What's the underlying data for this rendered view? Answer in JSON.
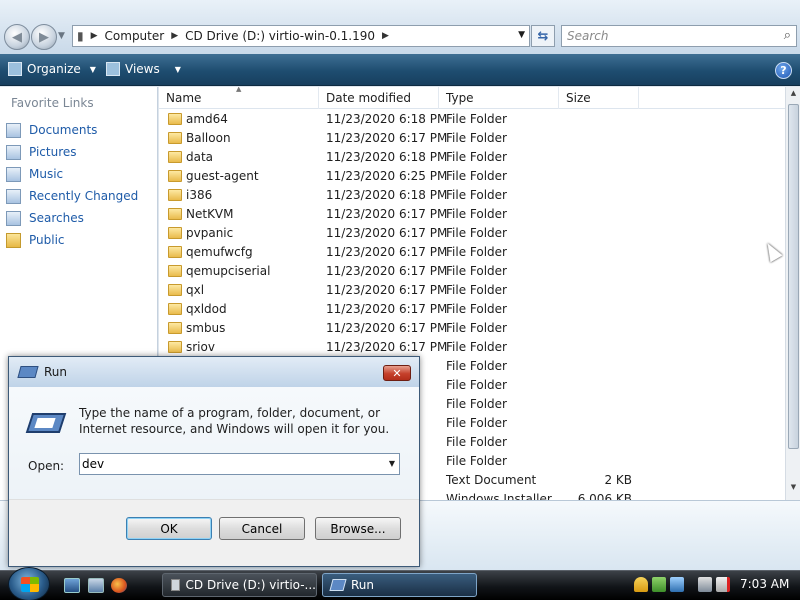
{
  "explorer": {
    "address": {
      "segments": [
        "Computer",
        "CD Drive (D:) virtio-win-0.1.190"
      ]
    },
    "search_placeholder": "Search",
    "toolbar": {
      "organize": "Organize",
      "views": "Views",
      "help": "?"
    },
    "nav_pane": {
      "heading": "Favorite Links",
      "items": [
        "Documents",
        "Pictures",
        "Music",
        "Recently Changed",
        "Searches",
        "Public"
      ]
    },
    "columns": {
      "name": "Name",
      "date": "Date modified",
      "type": "Type",
      "size": "Size"
    },
    "rows": [
      {
        "name": "amd64",
        "date": "11/23/2020 6:18 PM",
        "type": "File Folder",
        "size": ""
      },
      {
        "name": "Balloon",
        "date": "11/23/2020 6:17 PM",
        "type": "File Folder",
        "size": ""
      },
      {
        "name": "data",
        "date": "11/23/2020 6:18 PM",
        "type": "File Folder",
        "size": ""
      },
      {
        "name": "guest-agent",
        "date": "11/23/2020 6:25 PM",
        "type": "File Folder",
        "size": ""
      },
      {
        "name": "i386",
        "date": "11/23/2020 6:18 PM",
        "type": "File Folder",
        "size": ""
      },
      {
        "name": "NetKVM",
        "date": "11/23/2020 6:17 PM",
        "type": "File Folder",
        "size": ""
      },
      {
        "name": "pvpanic",
        "date": "11/23/2020 6:17 PM",
        "type": "File Folder",
        "size": ""
      },
      {
        "name": "qemufwcfg",
        "date": "11/23/2020 6:17 PM",
        "type": "File Folder",
        "size": ""
      },
      {
        "name": "qemupciserial",
        "date": "11/23/2020 6:17 PM",
        "type": "File Folder",
        "size": ""
      },
      {
        "name": "qxl",
        "date": "11/23/2020 6:17 PM",
        "type": "File Folder",
        "size": ""
      },
      {
        "name": "qxldod",
        "date": "11/23/2020 6:17 PM",
        "type": "File Folder",
        "size": ""
      },
      {
        "name": "smbus",
        "date": "11/23/2020 6:17 PM",
        "type": "File Folder",
        "size": ""
      },
      {
        "name": "sriov",
        "date": "11/23/2020 6:17 PM",
        "type": "File Folder",
        "size": ""
      },
      {
        "name": "",
        "date": "M",
        "type": "File Folder",
        "size": ""
      },
      {
        "name": "",
        "date": "M",
        "type": "File Folder",
        "size": ""
      },
      {
        "name": "",
        "date": "M",
        "type": "File Folder",
        "size": ""
      },
      {
        "name": "",
        "date": "M",
        "type": "File Folder",
        "size": ""
      },
      {
        "name": "",
        "date": "M",
        "type": "File Folder",
        "size": ""
      },
      {
        "name": "",
        "date": "M",
        "type": "File Folder",
        "size": ""
      },
      {
        "name": "",
        "date": "M",
        "type": "Text Document",
        "size": "2 KB"
      },
      {
        "name": "",
        "date": "M",
        "type": "Windows Installer",
        "size": "6,006 KB"
      }
    ]
  },
  "run_dialog": {
    "title": "Run",
    "close": "✕",
    "description": "Type the name of a program, folder, document, or Internet resource, and Windows will open it for you.",
    "open_label": "Open:",
    "open_value": "dev",
    "ok": "OK",
    "cancel": "Cancel",
    "browse": "Browse..."
  },
  "taskbar": {
    "tasks": [
      "CD Drive (D:) virtio-...",
      "Run"
    ],
    "clock": "7:03 AM"
  }
}
